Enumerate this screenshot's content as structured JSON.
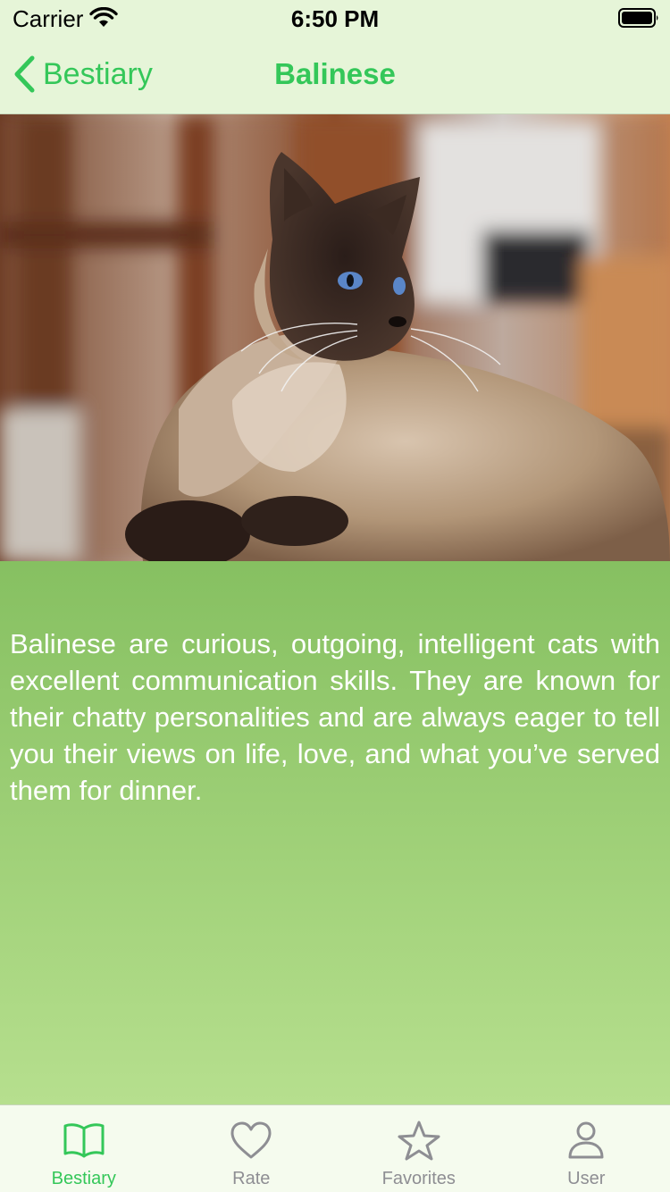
{
  "status_bar": {
    "carrier": "Carrier",
    "time": "6:50 PM"
  },
  "nav": {
    "back_label": "Bestiary",
    "title": "Balinese",
    "accent_color": "#34c759"
  },
  "photo": {
    "icon": "balinese-cat-photo"
  },
  "description": "Balinese are curious, outgoing, intelligent cats with excellent communication skills. They are known for their chatty personalities and are always eager to tell you their views on life, love, and what you’ve served them for dinner.",
  "tab_bar": {
    "tabs": [
      {
        "label": "Bestiary",
        "icon": "book-icon",
        "active": true
      },
      {
        "label": "Rate",
        "icon": "heart-icon",
        "active": false
      },
      {
        "label": "Favorites",
        "icon": "star-icon",
        "active": false
      },
      {
        "label": "User",
        "icon": "person-icon",
        "active": false
      }
    ]
  }
}
